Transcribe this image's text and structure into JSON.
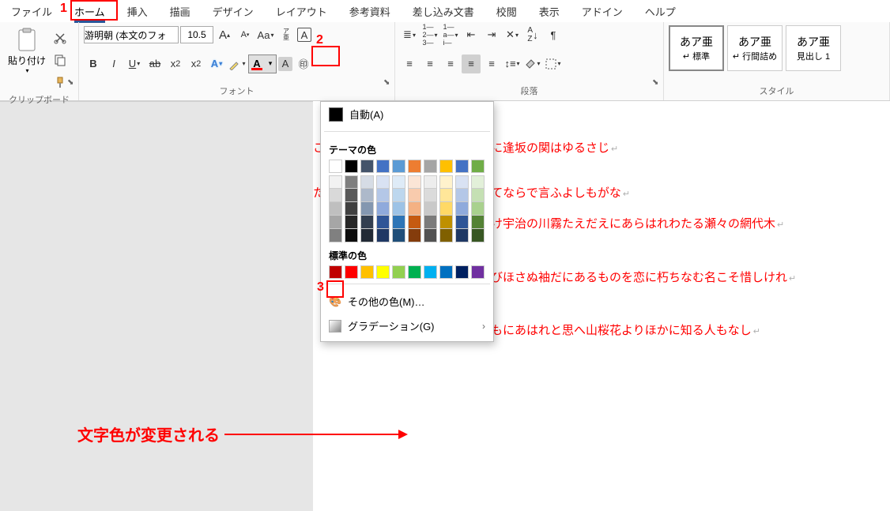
{
  "tabs": [
    "ファイル",
    "ホーム",
    "挿入",
    "描画",
    "デザイン",
    "レイアウト",
    "参考資料",
    "差し込み文書",
    "校閲",
    "表示",
    "アドイン",
    "ヘルプ"
  ],
  "active_tab_index": 1,
  "groups": {
    "clipboard": "クリップボード",
    "font": "フォント",
    "paragraph": "段落",
    "styles": "スタイル"
  },
  "clipboard": {
    "paste": "貼り付け"
  },
  "font": {
    "name": "游明朝 (本文のフォ",
    "size": "10.5"
  },
  "styles": [
    {
      "preview": "あア亜",
      "name": "↵ 標準"
    },
    {
      "preview": "あア亜",
      "name": "↵ 行間詰め"
    },
    {
      "preview": "あア亜",
      "name": "見出し 1"
    }
  ],
  "color_dropdown": {
    "auto": "自動(A)",
    "theme_header": "テーマの色",
    "theme_top": [
      "#ffffff",
      "#000000",
      "#44546a",
      "#4472c4",
      "#5b9bd5",
      "#ed7d31",
      "#a5a5a5",
      "#ffc000",
      "#4472c4",
      "#70ad47"
    ],
    "theme_shades": [
      [
        "#f2f2f2",
        "#d9d9d9",
        "#bfbfbf",
        "#a6a6a6",
        "#808080"
      ],
      [
        "#7f7f7f",
        "#595959",
        "#404040",
        "#262626",
        "#0d0d0d"
      ],
      [
        "#d6dce5",
        "#adb9ca",
        "#8497b0",
        "#333f50",
        "#222a35"
      ],
      [
        "#d9e2f3",
        "#b4c7e7",
        "#8faadc",
        "#2f5597",
        "#1f3864"
      ],
      [
        "#deebf7",
        "#bdd7ee",
        "#9dc3e6",
        "#2e75b6",
        "#1f4e79"
      ],
      [
        "#fbe5d6",
        "#f8cbad",
        "#f4b183",
        "#c55a11",
        "#843c0c"
      ],
      [
        "#ededed",
        "#dbdbdb",
        "#c9c9c9",
        "#7b7b7b",
        "#525252"
      ],
      [
        "#fff2cc",
        "#ffe699",
        "#ffd966",
        "#bf9000",
        "#806000"
      ],
      [
        "#d9e2f3",
        "#b4c7e7",
        "#8faadc",
        "#2f5597",
        "#1f3864"
      ],
      [
        "#e2f0d9",
        "#c5e0b4",
        "#a9d18e",
        "#548235",
        "#385723"
      ]
    ],
    "standard_header": "標準の色",
    "standard": [
      "#c00000",
      "#ff0000",
      "#ffc000",
      "#ffff00",
      "#92d050",
      "#00b050",
      "#00b0f0",
      "#0070c0",
      "#002060",
      "#7030a0"
    ],
    "more": "その他の色(M)…",
    "gradient": "グラデーション(G)"
  },
  "document_lines": [
    "こめて鳥のそら音ははかるとも世に逢坂の関はゆるさじ",
    "ただ思ひ絶えなむとばかりを人づてならで言ふよしもがな",
    "朝ぼらけ宇治の川霧たえだえにあらはれわたる瀬々の網代木",
    "恨みわびほさぬ袖だにあるものを恋に朽ちなむ名こそ惜しけれ",
    "もろともにあはれと思へ山桜花よりほかに知る人もなし"
  ],
  "callouts": {
    "c1": "1",
    "c2": "2",
    "c3": "3",
    "annotation": "文字色が変更される"
  }
}
